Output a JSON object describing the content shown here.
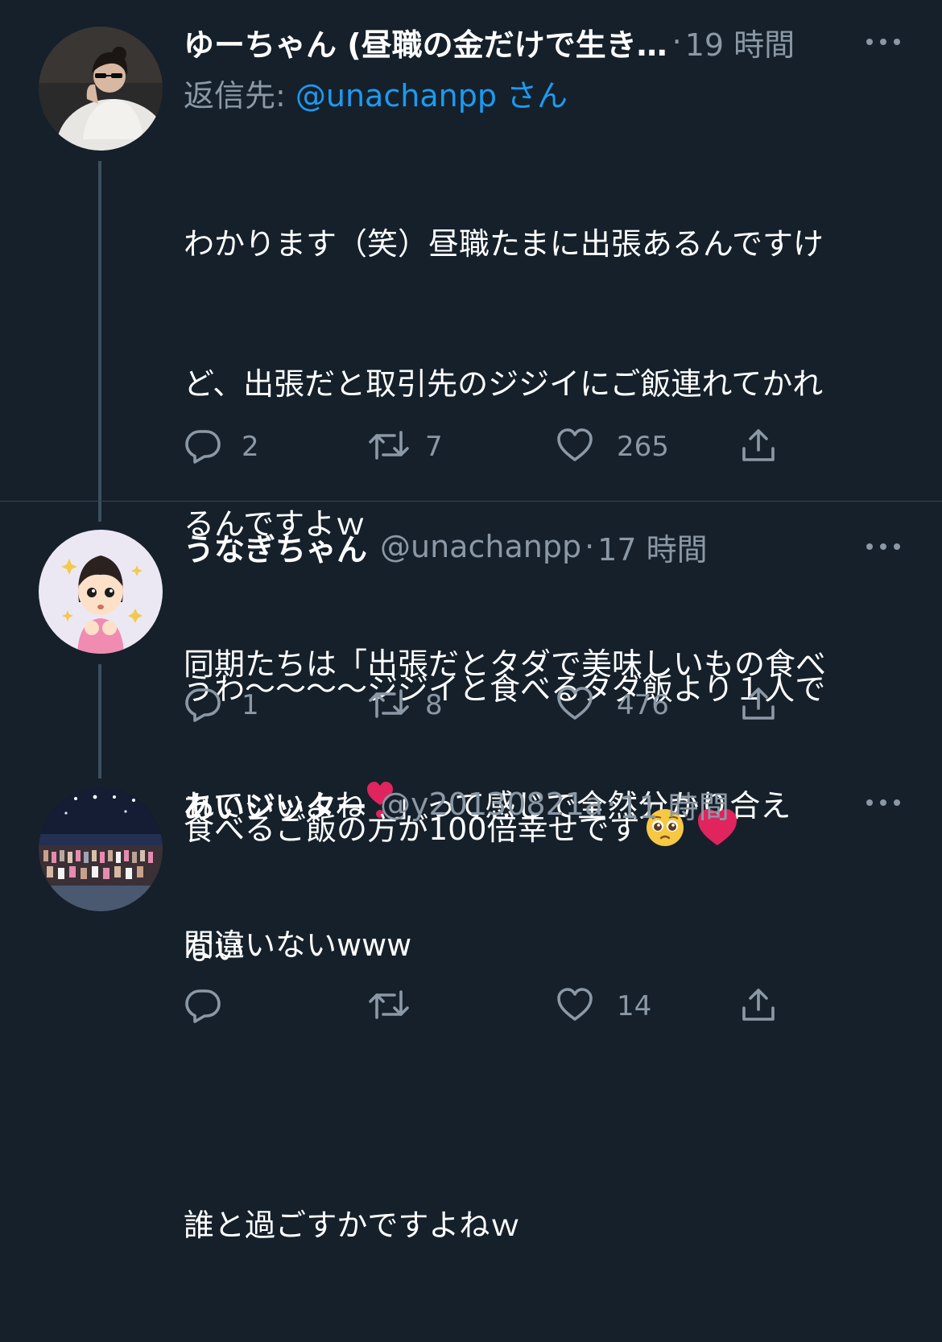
{
  "tweets": [
    {
      "display_name": "ゆーちゃん (昼職の金だけで生き…",
      "sep": "·",
      "time": "19 時間",
      "reply_prefix": "返信先: ",
      "reply_mention": "@unachanpp",
      "reply_suffix": " さん",
      "text_line1": "わかります（笑）昼職たまに出張あるんですけ",
      "text_line2": "ど、出張だと取引先のジジイにご飯連れてかれ",
      "text_line3": "るんですよｗ",
      "text_line4": "同期たちは「出張だとタダで美味しいもの食べ",
      "text_line5a": "れていいよね",
      "text_line5b": "」って感じで全然分かり合え",
      "text_line6": "ない",
      "replies": "2",
      "retweets": "7",
      "likes": "265"
    },
    {
      "display_name": "うなぎちゃん",
      "handle": "@unachanpp",
      "sep": "·",
      "time": "17 時間",
      "text_line1": "うわ〜〜〜〜ジジイと食べるタダ飯より１人で",
      "text_line2": "食べるご飯の方が100倍幸せです",
      "replies": "1",
      "retweets": "8",
      "likes": "476"
    },
    {
      "display_name": "あいジッター",
      "handle": "@y20130821a",
      "sep": "·",
      "time": "11 時間",
      "text_line1": "間違いないwww",
      "text_line2": "",
      "text_line3": "誰と過ごすかですよねｗ",
      "likes": "14"
    }
  ],
  "colors": {
    "background": "#15202b",
    "text": "#ffffff",
    "secondary": "#8b98a5",
    "link": "#1d9bf0",
    "heart_emoji": "#e0245e",
    "thread_line": "#3d4f5e"
  },
  "icons": {
    "reply": "reply-icon",
    "retweet": "retweet-icon",
    "like": "like-icon",
    "share": "share-icon",
    "more": "more-icon"
  }
}
